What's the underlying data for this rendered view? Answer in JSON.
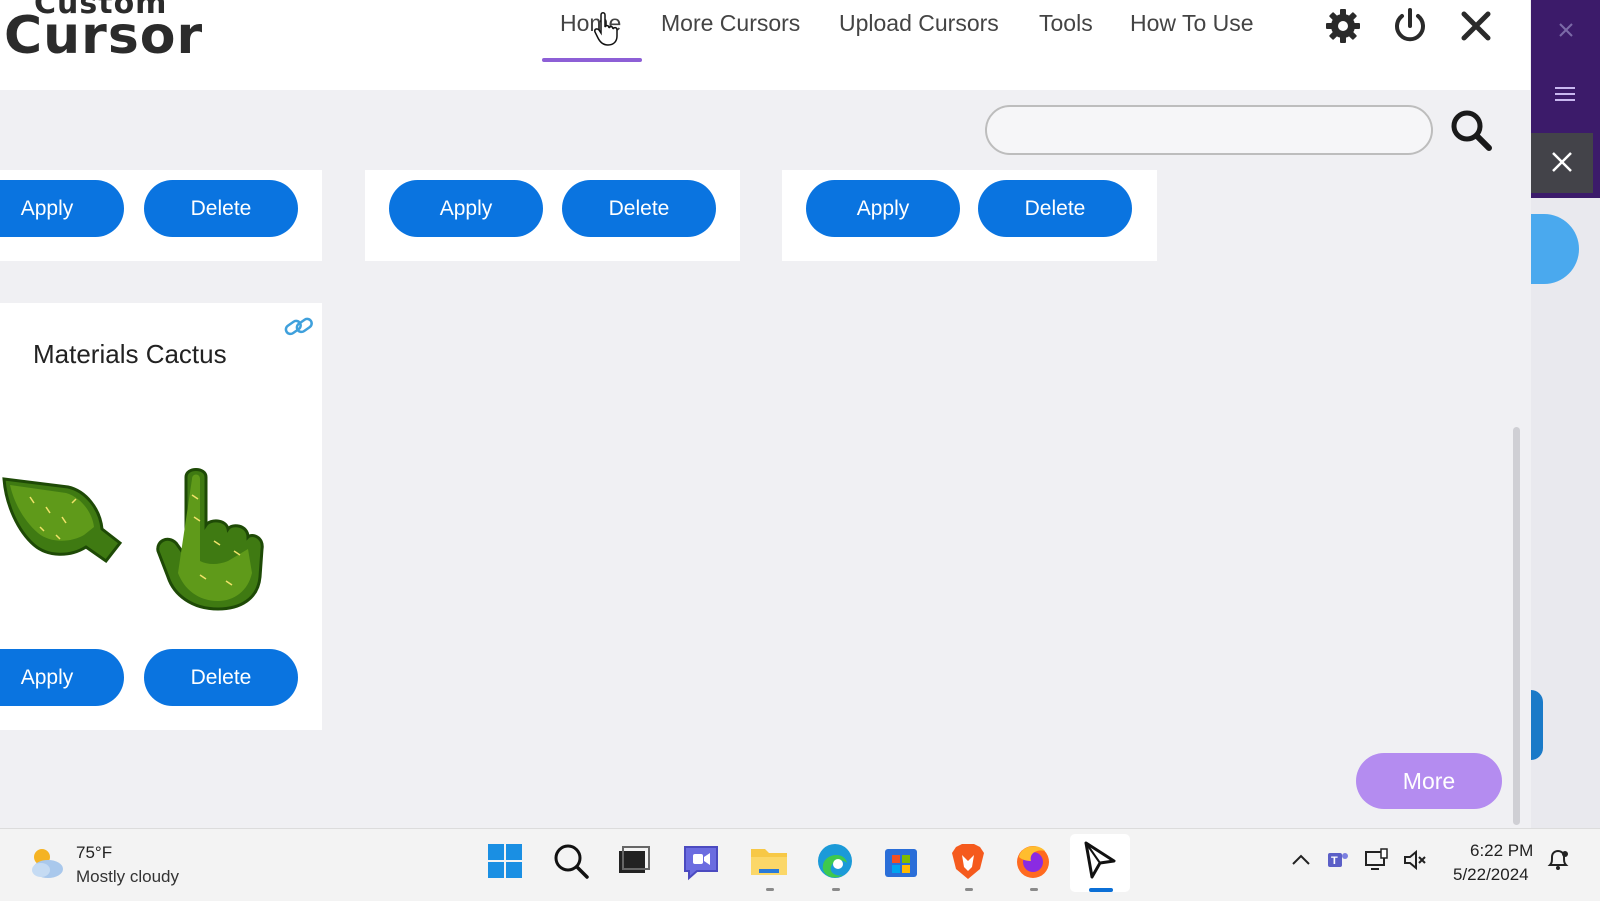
{
  "app": {
    "logo": {
      "line1": "Custom",
      "line2": "Cursor"
    },
    "nav": [
      {
        "label": "Home",
        "active": true
      },
      {
        "label": "More Cursors"
      },
      {
        "label": "Upload Cursors"
      },
      {
        "label": "Tools"
      },
      {
        "label": "How To Use"
      }
    ],
    "header_icons": [
      "gear-icon",
      "power-icon",
      "close-icon"
    ],
    "search": {
      "placeholder": "",
      "value": ""
    },
    "cards_top": [
      {
        "apply_label": "Apply",
        "delete_label": "Delete"
      },
      {
        "apply_label": "Apply",
        "delete_label": "Delete"
      },
      {
        "apply_label": "Apply",
        "delete_label": "Delete"
      }
    ],
    "featured_card": {
      "title": "Materials Cactus",
      "apply_label": "Apply",
      "delete_label": "Delete",
      "icons": [
        "link-icon",
        "cactus-arrow-cursor",
        "cactus-hand-cursor"
      ]
    },
    "more_label": "More",
    "colors": {
      "primary_button": "#0a74e0",
      "more_button": "#b48cf0",
      "nav_underline": "#8d5fd6"
    }
  },
  "taskbar": {
    "weather": {
      "temp": "75°F",
      "desc": "Mostly cloudy"
    },
    "apps": [
      "start-icon",
      "search-icon",
      "task-view-icon",
      "chat-icon",
      "file-explorer-icon",
      "edge-icon",
      "store-icon",
      "brave-icon",
      "firefox-icon",
      "custom-cursor-icon"
    ],
    "tray": [
      "chevron-up-icon",
      "teams-icon",
      "network-icon",
      "volume-muted-icon",
      "notification-icon"
    ],
    "clock": {
      "time": "6:22 PM",
      "date": "5/22/2024"
    }
  }
}
